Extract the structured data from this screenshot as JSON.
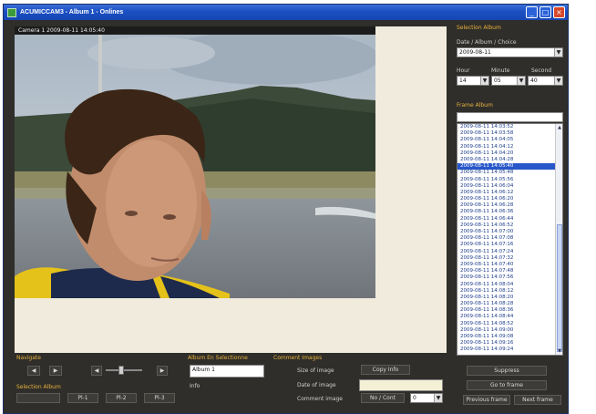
{
  "window": {
    "title": "ACUMICCAM3 - Album 1 - Onlines"
  },
  "camera": {
    "label": "Camera 1 2009-08-11 14:05:40"
  },
  "side": {
    "date_head": "Selection Album",
    "date_label": "Date / Album / Choice",
    "date_value": "2009-08-11",
    "hour_label": "Hour",
    "minute_label": "Minute",
    "second_label": "Second",
    "hour_value": "14",
    "minute_value": "05",
    "second_value": "40",
    "frames_head": "Frame Album",
    "frames": [
      "2009-08-11 14:03:52",
      "2009-08-11 14:03:58",
      "2009-08-11 14:04:05",
      "2009-08-11 14:04:12",
      "2009-08-11 14:04:20",
      "2009-08-11 14:04:28",
      "2009-08-11 14:05:40",
      "2009-08-11 14:05:48",
      "2009-08-11 14:05:56",
      "2009-08-11 14:06:04",
      "2009-08-11 14:06:12",
      "2009-08-11 14:06:20",
      "2009-08-11 14:06:28",
      "2009-08-11 14:06:36",
      "2009-08-11 14:06:44",
      "2009-08-11 14:06:52",
      "2009-08-11 14:07:00",
      "2009-08-11 14:07:08",
      "2009-08-11 14:07:16",
      "2009-08-11 14:07:24",
      "2009-08-11 14:07:32",
      "2009-08-11 14:07:40",
      "2009-08-11 14:07:48",
      "2009-08-11 14:07:56",
      "2009-08-11 14:08:04",
      "2009-08-11 14:08:12",
      "2009-08-11 14:08:20",
      "2009-08-11 14:08:28",
      "2009-08-11 14:08:36",
      "2009-08-11 14:08:44",
      "2009-08-11 14:08:52",
      "2009-08-11 14:09:00",
      "2009-08-11 14:09:08",
      "2009-08-11 14:09:16",
      "2009-08-11 14:09:24"
    ],
    "selected_index": 6
  },
  "controls": {
    "nav_head": "Navigate",
    "speed_head": "Selection Album",
    "speed_btns": [
      "Pl-1",
      "Pl-2",
      "Pl-3"
    ],
    "player_head": "Album En Selectionne",
    "player_value": "Album 1",
    "info_label": "Info",
    "comments_head": "Comment Images",
    "field1_label": "Size of image",
    "field1_btn": "Copy Info",
    "field2_label": "Date of image",
    "field3_label": "Comment image",
    "field3_btn": "No / Cont",
    "field3_select": "0",
    "right_btn1": "Suppress",
    "right_btn2": "Go to frame",
    "right_btn3": "Previous frame",
    "right_btn4": "Next frame"
  },
  "colors": {
    "accent": "#e8b23c",
    "titlebar": "#1b4fc2",
    "selected": "#2757c9"
  }
}
